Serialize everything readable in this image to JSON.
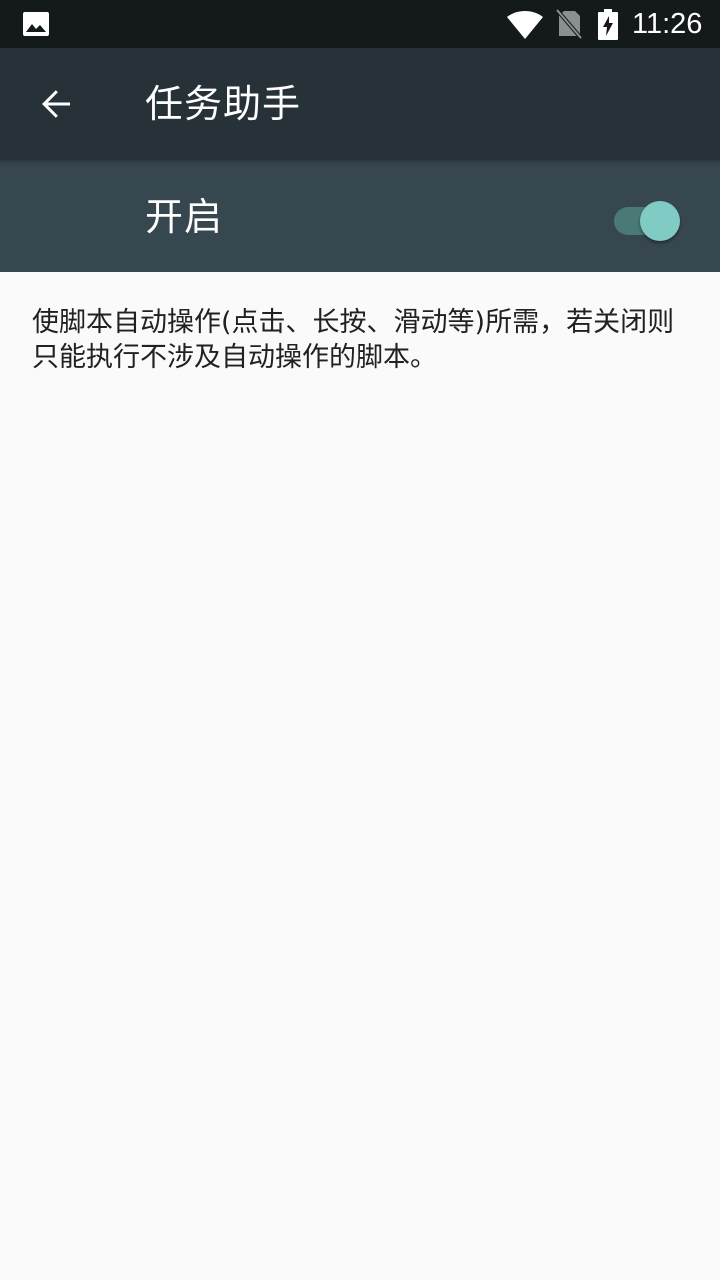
{
  "status_bar": {
    "time": "11:26",
    "icons": [
      "image-notification-icon",
      "wifi-icon",
      "no-sim-icon",
      "battery-charging-icon"
    ]
  },
  "app_bar": {
    "back_icon": "arrow-back-icon",
    "title": "任务助手"
  },
  "switch_bar": {
    "label": "开启",
    "state": "on"
  },
  "description": {
    "text": "使脚本自动操作(点击、长按、滑动等)所需，若关闭则只能执行不涉及自动操作的脚本。"
  },
  "colors": {
    "status_bar": "#14191c",
    "app_bar": "#263238",
    "switch_bar": "#37474f",
    "background": "#fafafa",
    "accent": "#80cbc4",
    "text_primary": "#212121"
  }
}
